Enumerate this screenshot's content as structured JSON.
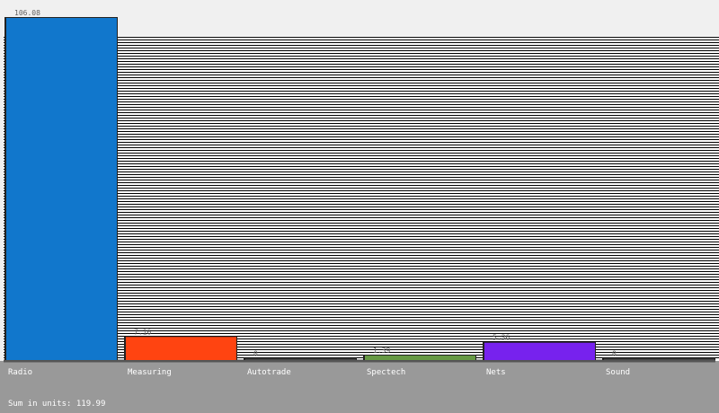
{
  "chart_data": {
    "type": "bar",
    "categories": [
      "Radio",
      "Measuring",
      "Autotrade",
      "Spectech",
      "Nets",
      "Sound"
    ],
    "values": [
      106.08,
      7.16,
      0,
      1.39,
      5.36,
      0
    ],
    "value_labels": [
      "106.08",
      "7.16",
      "0",
      "1.39",
      "5.36",
      "0"
    ],
    "colors": [
      "#1177cc",
      "#ff4411",
      "#444444",
      "#669944",
      "#7722ee",
      "#444444"
    ],
    "ylim": [
      0,
      106.08
    ],
    "grid": true,
    "title": "",
    "xlabel": "",
    "ylabel": "",
    "footer_label": "Sum in units:",
    "footer_value": "119.99",
    "background_color": "#f0f0f0",
    "plot_background_color": "#ffffff",
    "grid_color": "#000000",
    "bottom_panel_color": "#999999"
  }
}
